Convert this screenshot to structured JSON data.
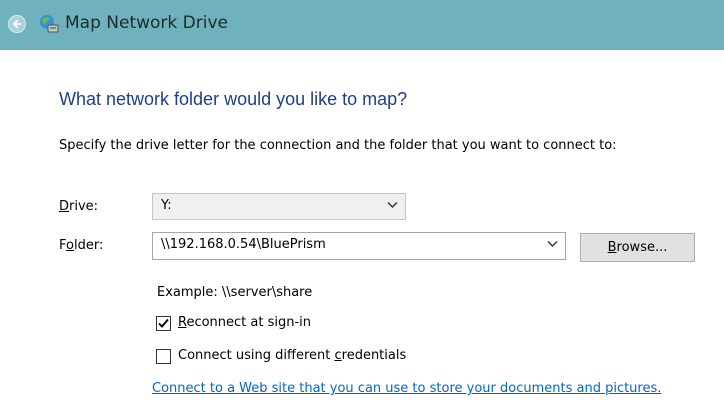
{
  "window": {
    "title": "Map Network Drive",
    "back_icon": "back-arrow-icon",
    "app_icon": "network-drive-icon"
  },
  "heading": "What network folder would you like to map?",
  "instruction": "Specify the drive letter for the connection and the folder that you want to connect to:",
  "drive": {
    "label_prefix": "",
    "label_access": "D",
    "label_suffix": "rive:",
    "value": "Y:"
  },
  "folder": {
    "label_prefix": "F",
    "label_access": "o",
    "label_suffix": "lder:",
    "value": "\\\\192.168.0.54\\BluePrism"
  },
  "browse": {
    "label_access": "B",
    "label_suffix": "rowse..."
  },
  "example": "Example: \\\\server\\share",
  "reconnect": {
    "checked": true,
    "label_access": "R",
    "label_suffix": "econnect at sign-in"
  },
  "credentials": {
    "checked": false,
    "label_prefix": "Connect using different ",
    "label_access": "c",
    "label_suffix": "redentials"
  },
  "link": "Connect to a Web site that you can use to store your documents and pictures."
}
